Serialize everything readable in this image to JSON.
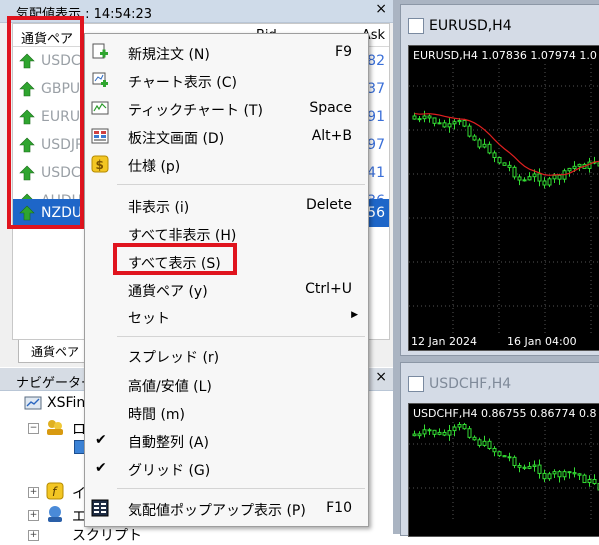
{
  "market_watch": {
    "title": "気配値表示 : 14:54:23",
    "close": "×",
    "col_symbol": "通貨ペア",
    "col_bid": "Bid",
    "col_ask": "Ask",
    "rows": [
      {
        "symbol": "USDCHF",
        "ask": "82"
      },
      {
        "symbol": "GBPUSD",
        "ask": "37"
      },
      {
        "symbol": "EURUSD",
        "ask": "91"
      },
      {
        "symbol": "USDJPY",
        "ask": "97"
      },
      {
        "symbol": "USDCAD",
        "ask": "41"
      },
      {
        "symbol": "AUDUSD",
        "ask": "36"
      },
      {
        "symbol": "NZDUSD",
        "ask": "56"
      }
    ],
    "tab": "通貨ペア"
  },
  "navigator": {
    "title": "ナビゲーター",
    "close": "×",
    "items": [
      "XSFin",
      "ロ",
      "イ",
      "エ",
      "スクリプト"
    ]
  },
  "charts": [
    {
      "title": "EURUSD,H4",
      "label": "EURUSD,H4  1.07836 1.07974 1.0",
      "ticks": [
        "12 Jan 2024",
        "16 Jan 04:00"
      ]
    },
    {
      "title": "USDCHF,H4",
      "label": "USDCHF,H4  0.86755 0.86774 0.8",
      "ticks": []
    }
  ],
  "context_menu": {
    "items": [
      {
        "label": "新規注文 (N)",
        "shortcut": "F9",
        "icon": "new-order-icon"
      },
      {
        "label": "チャート表示 (C)",
        "shortcut": "",
        "icon": "chart-window-icon"
      },
      {
        "label": "ティックチャート (T)",
        "shortcut": "Space",
        "icon": "tick-chart-icon"
      },
      {
        "label": "板注文画面 (D)",
        "shortcut": "Alt+B",
        "icon": "depth-of-market-icon"
      },
      {
        "label": "仕様 (p)",
        "shortcut": "",
        "icon": "specification-icon"
      },
      {
        "label": "非表示 (i)",
        "shortcut": "Delete",
        "icon": ""
      },
      {
        "label": "すべて非表示 (H)",
        "shortcut": "",
        "icon": ""
      },
      {
        "label": "すべて表示 (S)",
        "shortcut": "",
        "icon": ""
      },
      {
        "label": "通貨ペア (y)",
        "shortcut": "Ctrl+U",
        "icon": ""
      },
      {
        "label": "セット",
        "shortcut": "",
        "icon": ""
      },
      {
        "label": "スプレッド (r)",
        "shortcut": "",
        "icon": ""
      },
      {
        "label": "高値/安値 (L)",
        "shortcut": "",
        "icon": ""
      },
      {
        "label": "時間 (m)",
        "shortcut": "",
        "icon": ""
      },
      {
        "label": "自動整列 (A)",
        "shortcut": "",
        "icon": "checkmark-icon"
      },
      {
        "label": "グリッド (G)",
        "shortcut": "",
        "icon": "checkmark-icon"
      },
      {
        "label": "気配値ポップアップ表示 (P)",
        "shortcut": "F10",
        "icon": "popup-prices-icon"
      }
    ],
    "submenu_arrow": "▶",
    "check": "✔"
  },
  "colors": {
    "highlight": "#e0141e",
    "selection": "#1e66c8",
    "up_arrow": "#2fa52f",
    "bull": "#33dd33",
    "ma": "#e02020"
  }
}
